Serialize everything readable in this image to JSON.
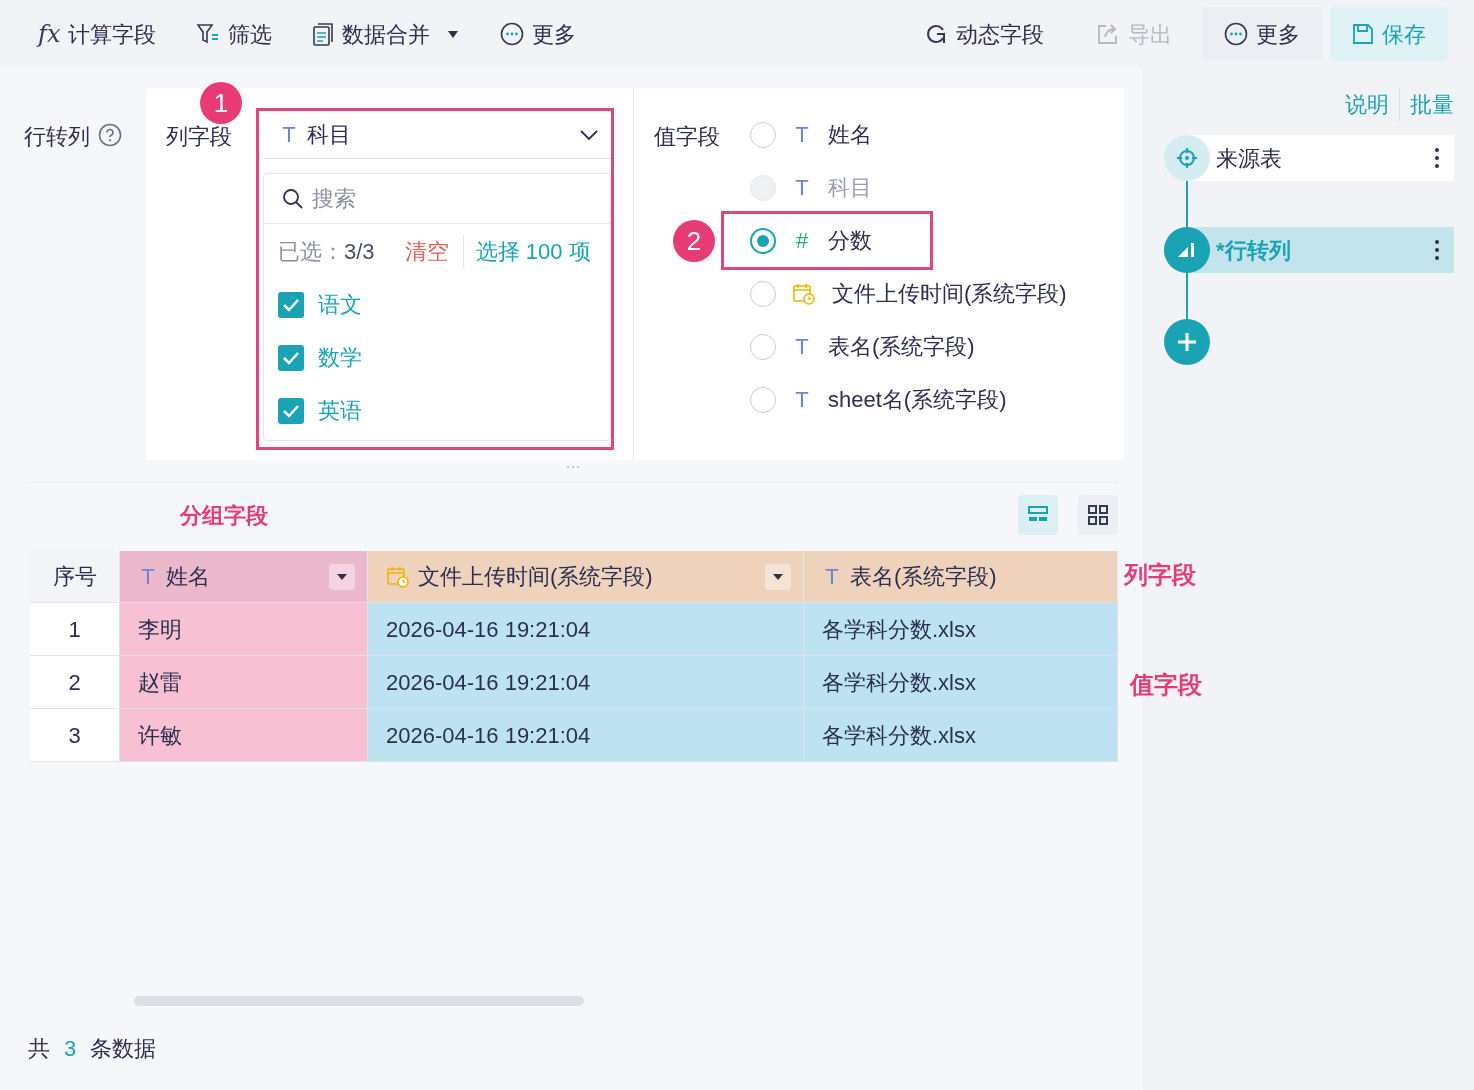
{
  "toolbar": {
    "left": [
      {
        "label": "计算字段",
        "icon_text": "fx",
        "dropdown": false
      },
      {
        "label": "筛选",
        "dropdown": false
      },
      {
        "label": "数据合并",
        "dropdown": true
      },
      {
        "label": "更多",
        "dropdown": false
      }
    ],
    "right": [
      {
        "label": "动态字段",
        "kind": "plain",
        "disabled": false
      },
      {
        "label": "导出",
        "kind": "plain",
        "disabled": true
      },
      {
        "label": "更多",
        "kind": "secondary",
        "disabled": false
      },
      {
        "label": "保存",
        "kind": "primary",
        "disabled": false
      }
    ]
  },
  "config": {
    "title": "行转列",
    "column_field": {
      "label": "列字段",
      "badge": "1",
      "glyph": "T",
      "value": "科目",
      "search_placeholder": "搜索",
      "selected_label": "已选：",
      "selected_count": "3/3",
      "clear": "清空",
      "select_all": "选择 100 项",
      "options": [
        {
          "label": "语文",
          "checked": true
        },
        {
          "label": "数学",
          "checked": true
        },
        {
          "label": "英语",
          "checked": true
        }
      ]
    },
    "value_field": {
      "label": "值字段",
      "badge": "2",
      "options": [
        {
          "label": "姓名",
          "kind": "text",
          "glyph": "T",
          "selected": false,
          "disabled": false,
          "highlighted": false
        },
        {
          "label": "科目",
          "kind": "text",
          "glyph": "T",
          "selected": false,
          "disabled": true,
          "highlighted": false
        },
        {
          "label": "分数",
          "kind": "number",
          "glyph": "#",
          "selected": true,
          "disabled": false,
          "highlighted": true
        },
        {
          "label": "文件上传时间(系统字段)",
          "kind": "date",
          "selected": false,
          "disabled": false,
          "highlighted": false
        },
        {
          "label": "表名(系统字段)",
          "kind": "text",
          "glyph": "T",
          "selected": false,
          "disabled": false,
          "highlighted": false
        },
        {
          "label": "sheet名(系统字段)",
          "kind": "text",
          "glyph": "T",
          "selected": false,
          "disabled": false,
          "highlighted": false
        }
      ]
    }
  },
  "preview": {
    "group_label": "分组字段",
    "column_label": "列字段",
    "value_label": "值字段",
    "view_toggle": [
      {
        "selected": true
      },
      {
        "selected": false
      }
    ],
    "columns": [
      {
        "label": "序号",
        "kind": "index",
        "group_field": false,
        "column_field": false
      },
      {
        "label": "姓名",
        "kind": "text",
        "glyph": "T",
        "group_field": true,
        "column_field": false
      },
      {
        "label": "文件上传时间(系统字段)",
        "kind": "date",
        "group_field": false,
        "column_field": true
      },
      {
        "label": "表名(系统字段)",
        "kind": "text",
        "glyph": "T",
        "group_field": false,
        "column_field": true
      }
    ],
    "rows": [
      [
        "1",
        "李明",
        "2026-04-16 19:21:04",
        "各学科分数.xlsx"
      ],
      [
        "2",
        "赵雷",
        "2026-04-16 19:21:04",
        "各学科分数.xlsx"
      ],
      [
        "3",
        "许敏",
        "2026-04-16 19:21:04",
        "各学科分数.xlsx"
      ]
    ]
  },
  "footer": {
    "prefix": "共",
    "count": "3",
    "suffix": "条数据"
  },
  "sidebar": {
    "links": [
      "说明",
      "批量"
    ],
    "steps": [
      {
        "label": "来源表",
        "kind": "source",
        "selected": false
      },
      {
        "label": "*行转列",
        "kind": "transform",
        "selected": true
      }
    ]
  }
}
